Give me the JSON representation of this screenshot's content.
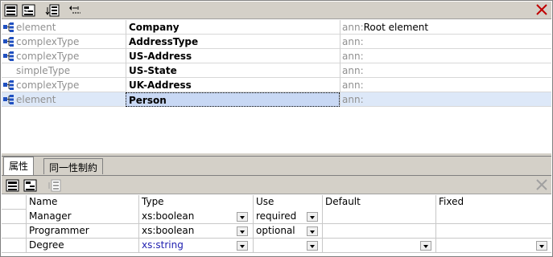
{
  "components": [
    {
      "kind": "element",
      "name": "Company",
      "ann_prefix": "ann:",
      "ann_value": "Root element",
      "selected": false
    },
    {
      "kind": "complexType",
      "name": "AddressType",
      "ann_prefix": "ann:",
      "ann_value": "",
      "selected": false
    },
    {
      "kind": "complexType",
      "name": "US-Address",
      "ann_prefix": "ann:",
      "ann_value": "",
      "selected": false
    },
    {
      "kind": "simpleType",
      "name": "US-State",
      "ann_prefix": "ann:",
      "ann_value": "",
      "selected": false
    },
    {
      "kind": "complexType",
      "name": "UK-Address",
      "ann_prefix": "ann:",
      "ann_value": "",
      "selected": false
    },
    {
      "kind": "element",
      "name": "Person",
      "ann_prefix": "ann:",
      "ann_value": "",
      "selected": true
    }
  ],
  "tabs": [
    {
      "label": "属性",
      "active": true
    },
    {
      "label": "同一性制約",
      "active": false
    }
  ],
  "attributes": {
    "columns": [
      "Name",
      "Type",
      "Use",
      "Default",
      "Fixed"
    ],
    "rows": [
      {
        "name": "Manager",
        "type": "xs:boolean",
        "use": "required",
        "default": "",
        "fixed": ""
      },
      {
        "name": "Programmer",
        "type": "xs:boolean",
        "use": "optional",
        "default": "",
        "fixed": ""
      },
      {
        "name": "Degree",
        "type": "xs:string",
        "use": "",
        "default": "",
        "fixed": ""
      }
    ]
  },
  "icons": {
    "toolbar": [
      "append-icon",
      "insert-icon",
      "add-child-icon",
      "collapse-icon",
      "close-icon"
    ],
    "lower_toolbar": [
      "append-icon",
      "insert-icon",
      "add-child-icon",
      "close-icon"
    ]
  },
  "colors": {
    "selection": "#dde8f8",
    "kind_text": "#909090",
    "link_text": "#2020b0",
    "close_red": "#c00000"
  }
}
